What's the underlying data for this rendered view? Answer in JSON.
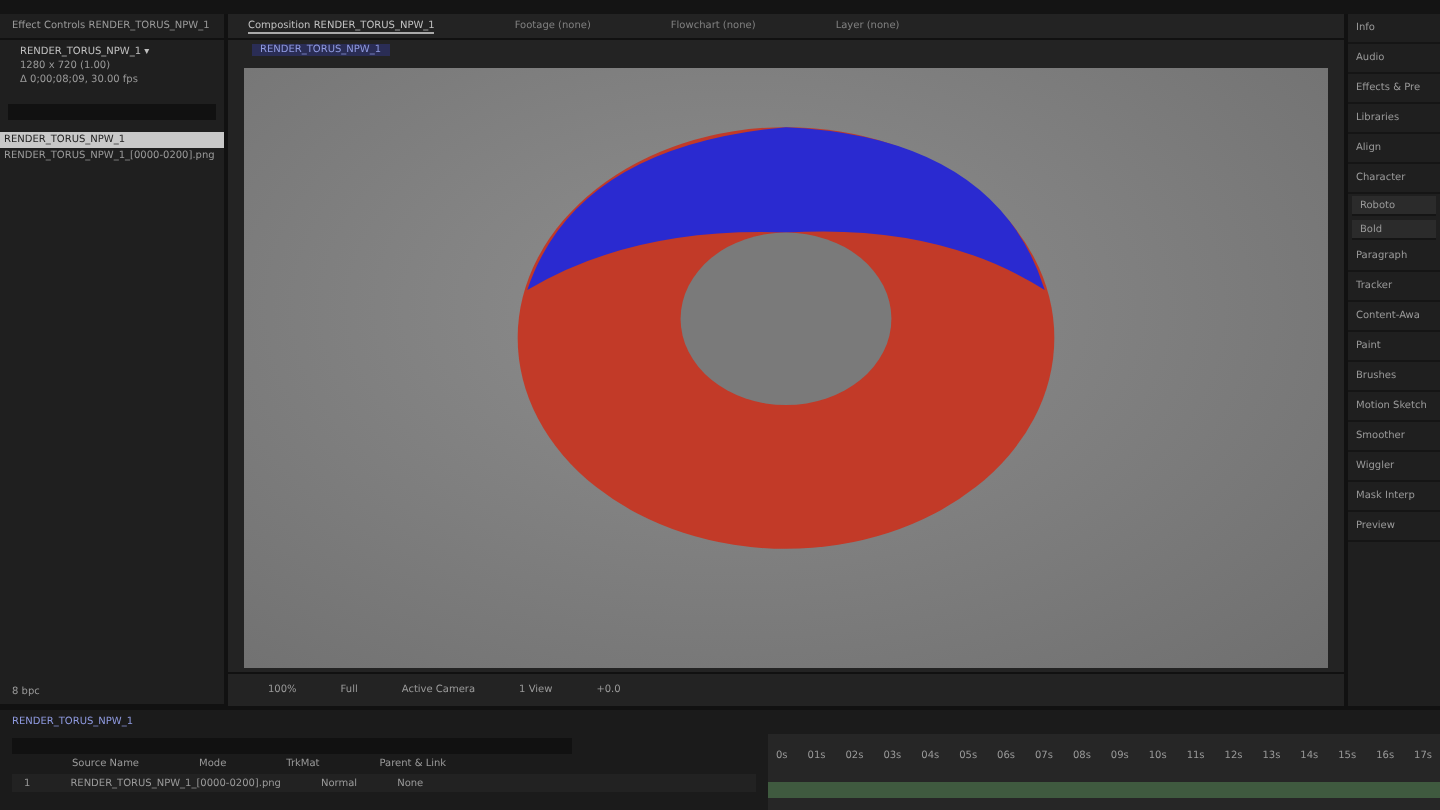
{
  "left_panel": {
    "tab": "Effect Controls RENDER_TORUS_NPW_1",
    "item_name": "RENDER_TORUS_NPW_1 ▾",
    "item_info": [
      "1280 x 720 (1.00)",
      "Δ 0;00;08;09, 30.00 fps"
    ],
    "project_items": [
      {
        "name": "RENDER_TORUS_NPW_1",
        "selected": true
      },
      {
        "name": "RENDER_TORUS_NPW_1_[0000-0200].png",
        "selected": false
      }
    ],
    "footer": "8 bpc"
  },
  "viewer_tabs": [
    {
      "label": "Composition RENDER_TORUS_NPW_1",
      "selected": true
    },
    {
      "label": "Footage (none)",
      "selected": false
    },
    {
      "label": "Flowchart (none)",
      "selected": false
    },
    {
      "label": "Layer (none)",
      "selected": false
    }
  ],
  "breadcrumb": "RENDER_TORUS_NPW_1",
  "viewer_toolbar": [
    "100%",
    "Full",
    "Active Camera",
    "1 View",
    "+0.0"
  ],
  "right_panel": [
    {
      "label": "Info",
      "kind": "header"
    },
    {
      "label": "Audio",
      "kind": "header"
    },
    {
      "label": "Effects & Pre",
      "kind": "header"
    },
    {
      "label": "Libraries",
      "kind": "header"
    },
    {
      "label": "Align",
      "kind": "header"
    },
    {
      "label": "Character",
      "kind": "header"
    },
    {
      "label": "Roboto",
      "kind": "field"
    },
    {
      "label": "Bold",
      "kind": "field"
    },
    {
      "label": "Paragraph",
      "kind": "header"
    },
    {
      "label": "Tracker",
      "kind": "header"
    },
    {
      "label": "Content-Awa",
      "kind": "header"
    },
    {
      "label": "Paint",
      "kind": "header"
    },
    {
      "label": "Brushes",
      "kind": "header"
    },
    {
      "label": "Motion Sketch",
      "kind": "header"
    },
    {
      "label": "Smoother",
      "kind": "header"
    },
    {
      "label": "Wiggler",
      "kind": "header"
    },
    {
      "label": "Mask Interp",
      "kind": "header"
    },
    {
      "label": "Preview",
      "kind": "header"
    }
  ],
  "timeline": {
    "tab": "RENDER_TORUS_NPW_1",
    "columns": [
      "Source Name",
      "Mode",
      "TrkMat",
      "Parent & Link"
    ],
    "layers": [
      {
        "number": "1",
        "name": "RENDER_TORUS_NPW_1_[0000-0200].png",
        "mode": "Normal",
        "parent": "None"
      }
    ],
    "ticks": [
      "0s",
      "01s",
      "02s",
      "03s",
      "04s",
      "05s",
      "06s",
      "07s",
      "08s",
      "09s",
      "10s",
      "11s",
      "12s",
      "13s",
      "14s",
      "15s",
      "16s",
      "17s"
    ]
  }
}
